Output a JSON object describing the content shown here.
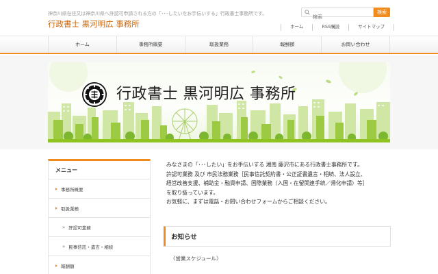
{
  "header": {
    "tagline": "神奈川県在住又は神奈川県へ許認可申請される方の「･･･したいをお手伝いする」行政書士事務所です。",
    "site_title": "行政書士 黒河明広 事務所",
    "search": {
      "placeholder": "検索",
      "button_label": "検索"
    },
    "util_nav": [
      "ホーム",
      "RSS購読",
      "サイトマップ"
    ]
  },
  "nav": [
    "ホーム",
    "事務所概要",
    "取扱業務",
    "報酬額",
    "お問い合わせ"
  ],
  "banner": {
    "title": "行政書士 黒河明広 事務所",
    "logo_icon": "office-seal-icon"
  },
  "sidebar": {
    "heading": "メニュー",
    "items": [
      {
        "label": "事務所概要",
        "level": 1
      },
      {
        "label": "取扱業務",
        "level": 1
      },
      {
        "label": "許認可業務",
        "level": 2
      },
      {
        "label": "民事信託・遺言・相続",
        "level": 2
      },
      {
        "label": "報酬額",
        "level": 1
      }
    ]
  },
  "main": {
    "intro_lines": [
      "みなさまの「･･･したい」をお手伝いする 湘南 藤沢市にある行政書士事務所です。",
      "許認可業務 及び 市民法務業務［民事信託契約書・公正証書遺言・相続、法人設立、",
      "経営改善支援、補助金・融資申請、国際業務（入国・在留関連手続／帰化申請）等］",
      "を取り扱っています。",
      "お気軽に、まずは電話・お問い合わせフォームからご相談ください。"
    ],
    "news_heading": "お知らせ",
    "news_item": "〈営業スケジュール〉"
  },
  "colors": {
    "accent": "#f08c1e",
    "title": "#c8650a",
    "banner_green": "#8fc31f"
  }
}
